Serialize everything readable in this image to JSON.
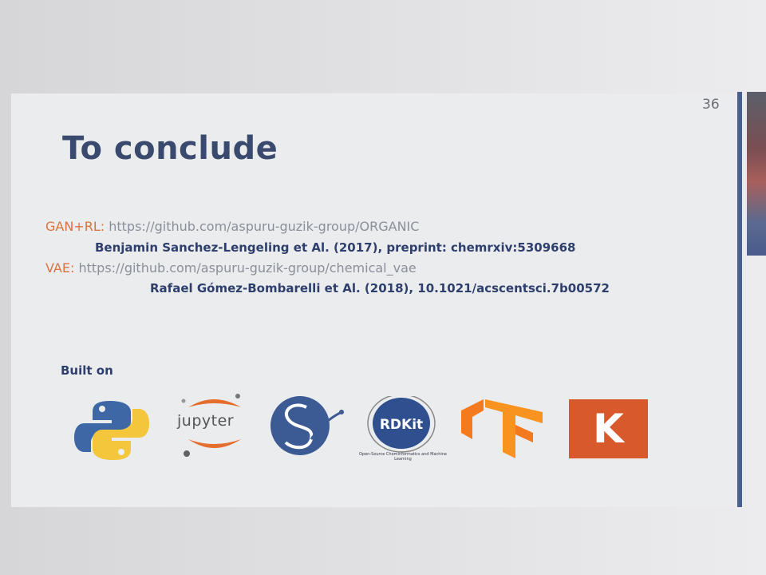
{
  "slide": {
    "page_number": "36",
    "title": "To conclude"
  },
  "references": [
    {
      "label": "GAN+RL:",
      "url": "https://github.com/aspuru-guzik-group/ORGANIC",
      "citation": "Benjamin Sanchez-Lengeling et Al. (2017), preprint: chemrxiv:5309668"
    },
    {
      "label": "VAE:",
      "url": "https://github.com/aspuru-guzik-group/chemical_vae",
      "citation": "Rafael Gómez-Bombarelli et Al. (2018), 10.1021/acscentsci.7b00572"
    }
  ],
  "built_on": {
    "heading": "Built on",
    "logos": [
      {
        "icon": "python-logo-icon"
      },
      {
        "icon": "jupyter-logo-icon",
        "text": "jupyter"
      },
      {
        "icon": "seaborn-logo-icon"
      },
      {
        "icon": "rdkit-logo-icon",
        "text": "RDKit",
        "caption": "Open-Source Cheminformatics and Machine Learning"
      },
      {
        "icon": "tensorflow-logo-icon"
      },
      {
        "icon": "keras-logo-icon",
        "text": "K"
      }
    ]
  },
  "colors": {
    "title": "#3a4a6e",
    "label": "#d9733e",
    "url": "#8b8f99",
    "citation": "#2e3f6d",
    "accent_bar": "#4b5f8f",
    "keras": "#d85a2c",
    "tensorflow": "#f47a20"
  }
}
